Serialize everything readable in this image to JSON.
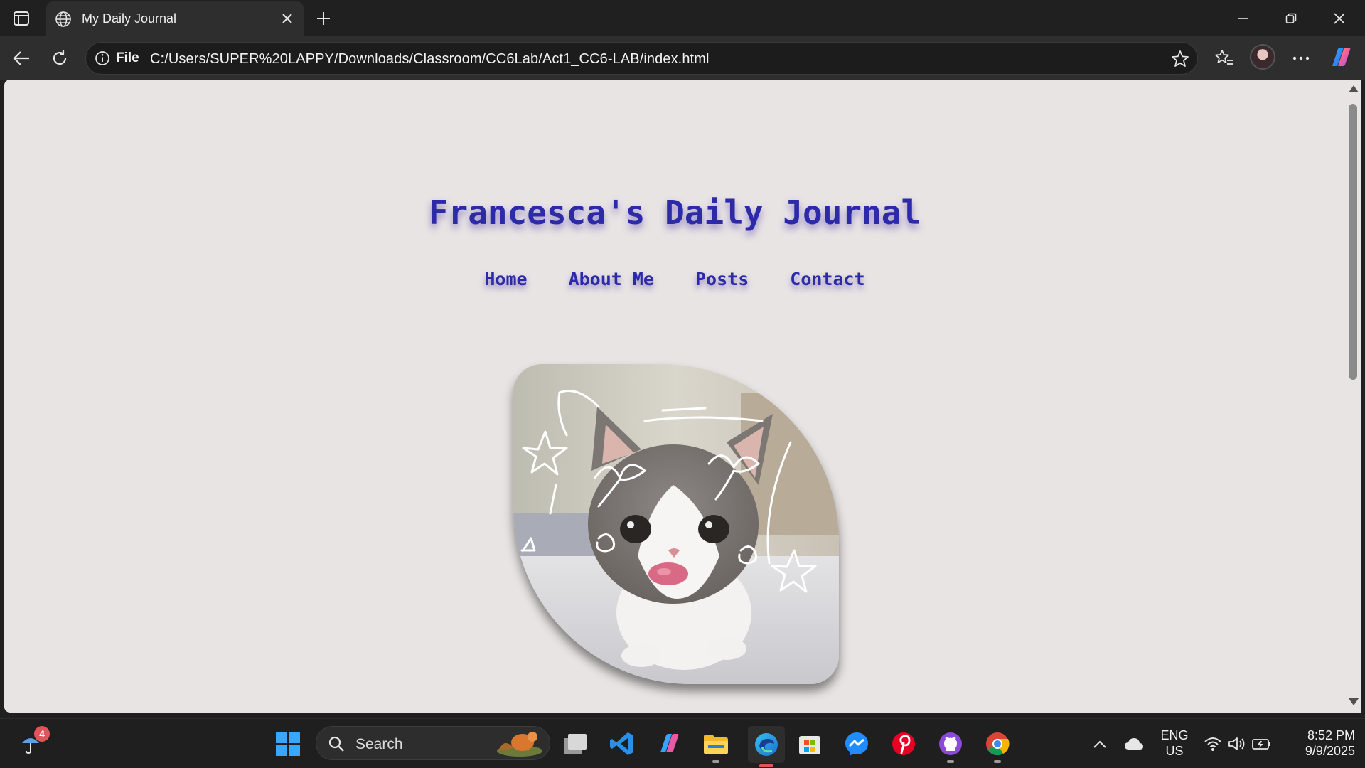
{
  "browser": {
    "tab_title": "My Daily Journal",
    "address_scheme_label": "File",
    "url": "C:/Users/SUPER%20LAPPY/Downloads/Classroom/CC6Lab/Act1_CC6-LAB/index.html"
  },
  "page": {
    "title": "Francesca's Daily Journal",
    "nav": [
      "Home",
      "About Me",
      "Posts",
      "Contact"
    ],
    "image_subject": "cat-photo",
    "title_color": "#2d2aa8",
    "background_color": "#e8e4e4"
  },
  "taskbar": {
    "search_label": "Search",
    "weather_badge_count": "4",
    "language_line1": "ENG",
    "language_line2": "US",
    "time": "8:52 PM",
    "date": "9/9/2025"
  }
}
